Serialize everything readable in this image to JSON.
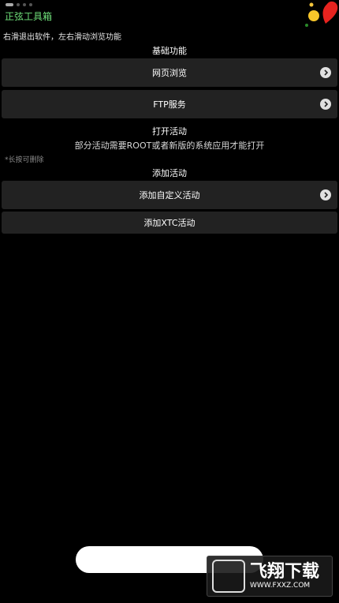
{
  "status": {
    "page_dots_count": 4
  },
  "app": {
    "title": "正弦工具箱"
  },
  "hint": {
    "text": "右滑退出软件，左右滑动浏览功能"
  },
  "sections": {
    "basic": {
      "title": "基础功能",
      "items": [
        {
          "label": "网页浏览",
          "icon": "chevron-right-icon"
        },
        {
          "label": "FTP服务",
          "icon": "chevron-right-icon"
        }
      ]
    },
    "open_activity": {
      "title": "打开活动",
      "subtitle": "部分活动需要ROOT或者新版的系统应用才能打开",
      "note": "*长按可删除"
    },
    "add_activity": {
      "title": "添加活动",
      "items": [
        {
          "label": "添加自定义活动",
          "icon": "chevron-right-icon"
        },
        {
          "label": "添加XTC活动"
        }
      ]
    }
  },
  "colors": {
    "title": "#6fe07a",
    "row_bg": "#222222",
    "background": "#000000"
  },
  "watermark": {
    "text": "飞翔下载",
    "url": "WWW.FXXZ.COM"
  }
}
